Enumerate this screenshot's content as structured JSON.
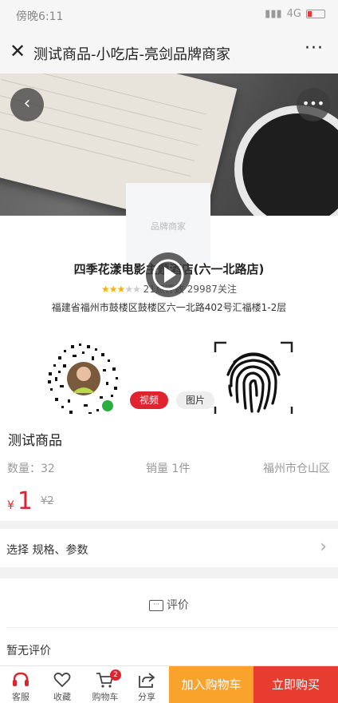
{
  "status": {
    "time": "傍晚6:11",
    "network": "4G"
  },
  "nav": {
    "title": "测试商品-小吃店-亮剑品牌商家",
    "close": "✕",
    "more": "···"
  },
  "shop": {
    "card_label": "品牌商家",
    "name": "四季花漾电影主题酒店(六一北路店)",
    "rating_text": "21点评数",
    "follow_text": "29987关注",
    "stars": 3,
    "address": "福建省福州市鼓楼区鼓楼区六一北路402号汇福楼1-2层"
  },
  "media_tabs": {
    "video": "视频",
    "image": "图片"
  },
  "product": {
    "title": "测试商品",
    "quantity": "数量：32",
    "sales": "销量 1件",
    "location": "福州市仓山区",
    "currency": "¥",
    "price": "1",
    "original_price": "¥2"
  },
  "spec": {
    "label": "选择 规格、参数",
    "arrow": "›"
  },
  "reviews": {
    "heading": "评价",
    "empty": "暂无评价"
  },
  "bottom": {
    "service": "客服",
    "favorite": "收藏",
    "cart": "购物车",
    "cart_count": "2",
    "share": "分享",
    "add_to_cart": "加入购物车",
    "buy_now": "立即购买"
  },
  "colors": {
    "accent": "#e0242f",
    "add_cart": "#f9a22c",
    "buy_now": "#e73c2f"
  }
}
